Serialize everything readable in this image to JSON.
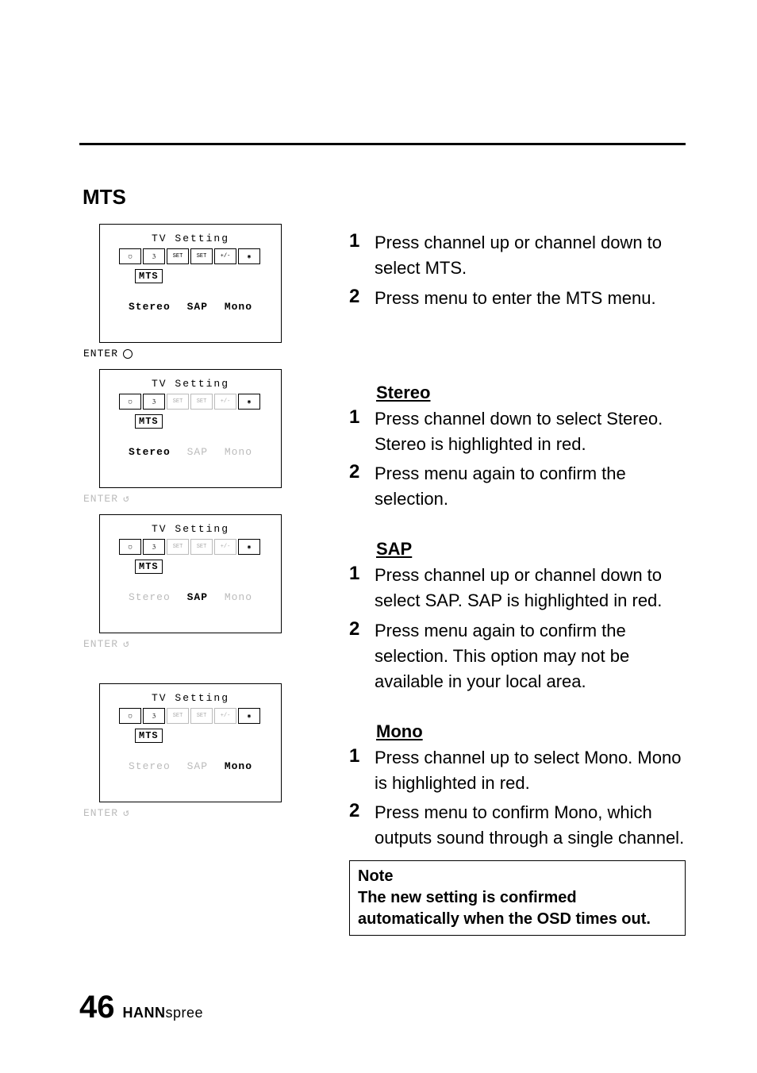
{
  "section_title": "MTS",
  "osd": {
    "title": "TV   Setting",
    "mts_label": "MTS",
    "icons": [
      "TV",
      "ANT",
      "AUTO SET",
      "MANU SET",
      "Channel +/-",
      "CC"
    ],
    "options": {
      "stereo": "Stereo",
      "sap": "SAP",
      "mono": "Mono"
    },
    "enter": "ENTER"
  },
  "intro_steps": [
    {
      "n": "1",
      "t": "Press channel up or channel down to select MTS."
    },
    {
      "n": "2",
      "t": "Press menu to enter the MTS menu."
    }
  ],
  "groups": [
    {
      "heading": "Stereo",
      "steps": [
        {
          "n": "1",
          "t": "Press channel down to select Stereo. Stereo is highlighted in red."
        },
        {
          "n": "2",
          "t": "Press menu again to confirm the selection."
        }
      ]
    },
    {
      "heading": "SAP",
      "steps": [
        {
          "n": "1",
          "t": "Press channel up or channel down to select SAP. SAP is highlighted in red."
        },
        {
          "n": "2",
          "t": "Press menu again to confirm the selection. This option may not be available in your local area."
        }
      ]
    },
    {
      "heading": "Mono",
      "steps": [
        {
          "n": "1",
          "t": "Press channel up to select Mono. Mono is highlighted in red."
        },
        {
          "n": "2",
          "t": "Press menu to confirm Mono, which outputs sound through a single channel."
        }
      ]
    }
  ],
  "note": {
    "title": "Note",
    "body": "The new setting is confirmed automatically when the OSD times out."
  },
  "footer": {
    "page": "46",
    "brand_bold": "HANN",
    "brand_rest": "spree"
  }
}
